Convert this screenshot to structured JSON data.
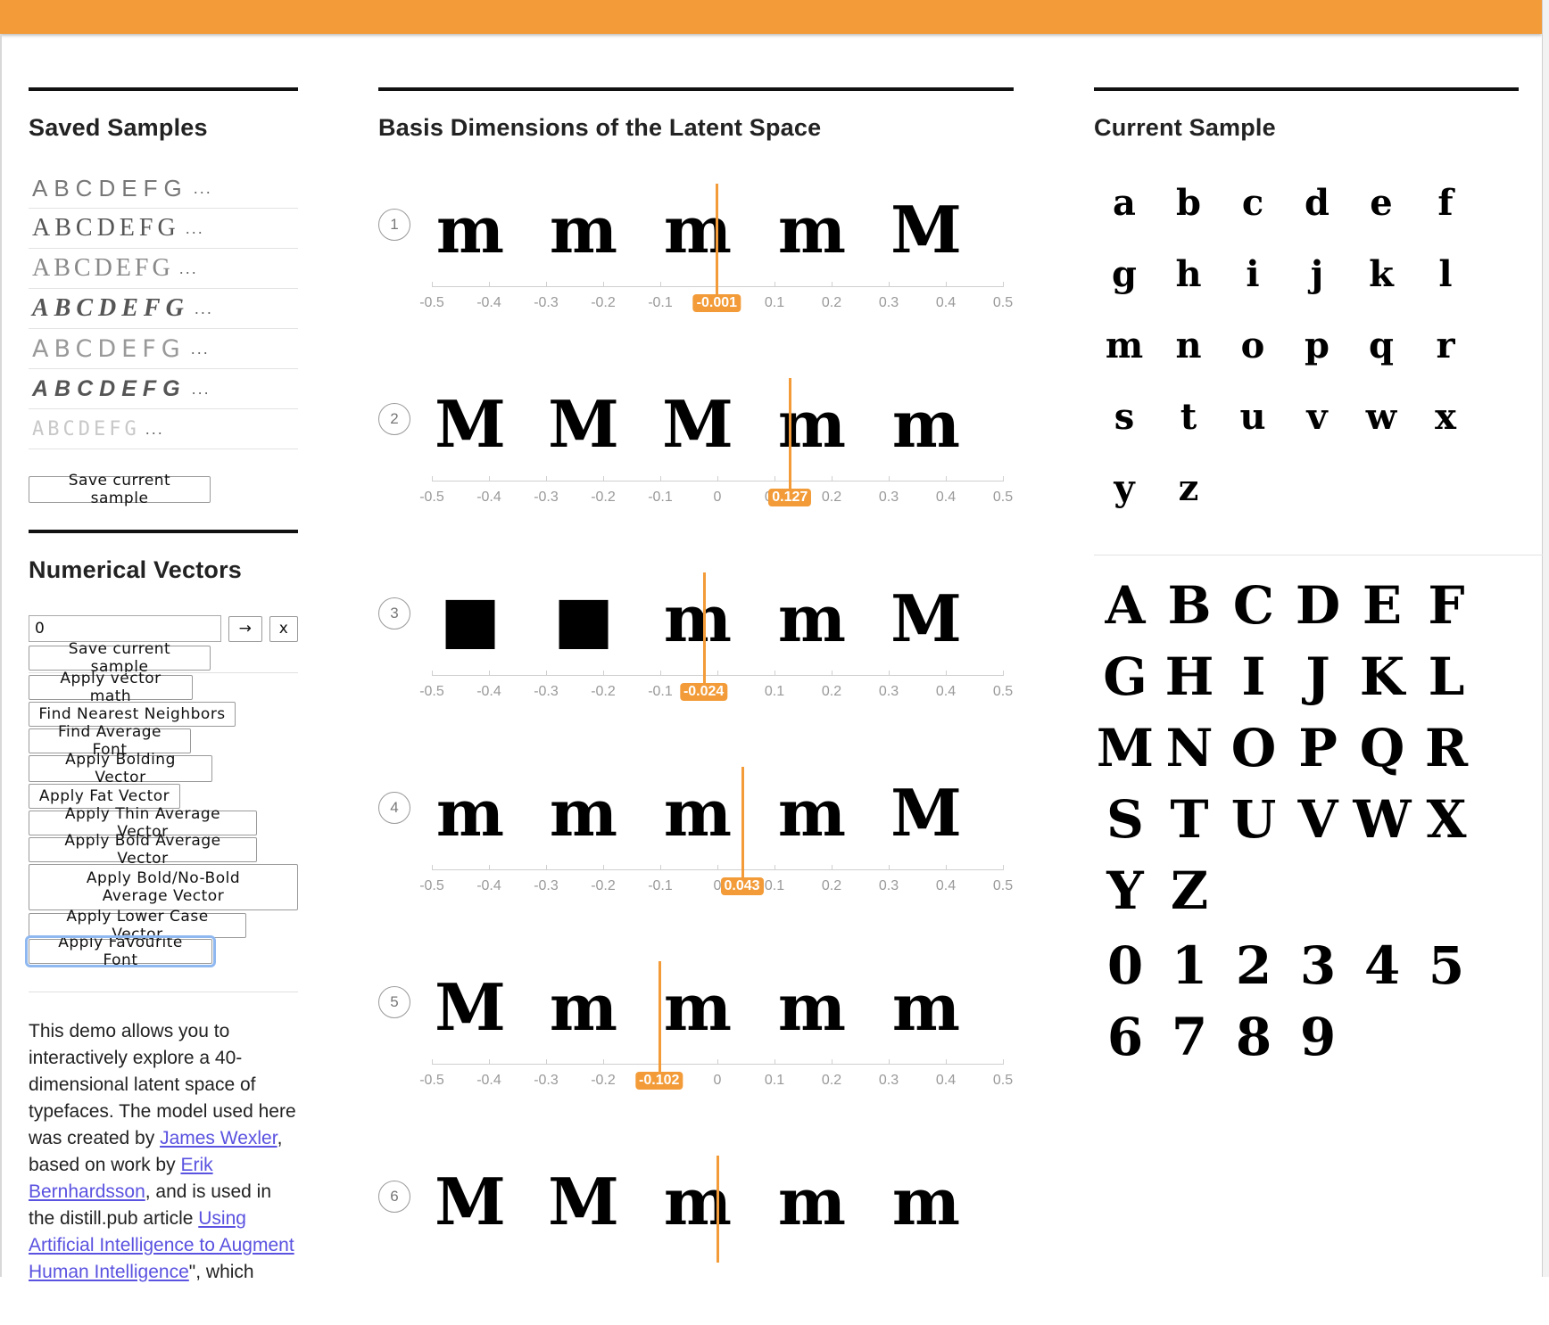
{
  "saved_samples": {
    "title": "Saved Samples",
    "items": [
      {
        "text": "ABCDEFG",
        "ellipsis": "..."
      },
      {
        "text": "ABCDEFG",
        "ellipsis": "..."
      },
      {
        "text": "ABCDEFG",
        "ellipsis": "..."
      },
      {
        "text": "ABCDEFG",
        "ellipsis": "..."
      },
      {
        "text": "ABCDEFG",
        "ellipsis": "..."
      },
      {
        "text": "ABCDEFG",
        "ellipsis": "..."
      },
      {
        "text": "ABCDEFG",
        "ellipsis": "..."
      }
    ],
    "save_button": "Save current sample"
  },
  "numerical_vectors": {
    "title": "Numerical Vectors",
    "input_value": "0",
    "go_button": "→",
    "clear_button": "x",
    "buttons": [
      "Save current sample",
      "Apply vector math",
      "Find Nearest Neighbors",
      "Find Average Font",
      "Apply Bolding Vector",
      "Apply Fat Vector",
      "Apply Thin Average Vector",
      "Apply Bold Average Vector",
      "Apply Bold/No-Bold Average Vector",
      "Apply Lower Case Vector",
      "Apply Favourite Font"
    ]
  },
  "about": {
    "p1": "This demo allows you to interactively explore a 40-dimensional latent space of typefaces. The model used here was created by ",
    "link1": "James Wexler",
    "p2": ", based on work by ",
    "link2": "Erik Bernhardsson",
    "p3": ", and is used in the distill.pub article ",
    "link3": "Using Artificial Intelligence to Augment Human Intelligence",
    "p4": "\", which"
  },
  "basis": {
    "title": "Basis Dimensions of the Latent Space",
    "tick_labels": [
      "-0.5",
      "-0.4",
      "-0.3",
      "-0.2",
      "-0.1",
      "0",
      "0.1",
      "0.2",
      "0.3",
      "0.4",
      "0.5"
    ],
    "dimensions": [
      {
        "number": "1",
        "value": -0.001,
        "label": "-0.001",
        "glyphs": [
          "m",
          "m",
          "m",
          "m",
          "M"
        ]
      },
      {
        "number": "2",
        "value": 0.127,
        "label": "0.127",
        "glyphs": [
          "M",
          "M",
          "M",
          "m",
          "m"
        ]
      },
      {
        "number": "3",
        "value": -0.024,
        "label": "-0.024",
        "glyphs": [
          "■",
          "■",
          "m",
          "m",
          "M"
        ]
      },
      {
        "number": "4",
        "value": 0.043,
        "label": "0.043",
        "glyphs": [
          "m",
          "m",
          "m",
          "m",
          "M"
        ]
      },
      {
        "number": "5",
        "value": -0.102,
        "label": "-0.102",
        "glyphs": [
          "M",
          "m",
          "m",
          "m",
          "m"
        ]
      },
      {
        "number": "6",
        "value": 0.0,
        "label": "",
        "glyphs": [
          "M",
          "M",
          "m",
          "m",
          "m"
        ]
      }
    ]
  },
  "current_sample": {
    "title": "Current Sample",
    "lowercase_glyphs": [
      "a",
      "b",
      "c",
      "d",
      "e",
      "f",
      "g",
      "h",
      "i",
      "j",
      "k",
      "l",
      "m",
      "n",
      "o",
      "p",
      "q",
      "r",
      "s",
      "t",
      "u",
      "v",
      "w",
      "x",
      "y",
      "z"
    ],
    "uppercase_glyphs": [
      "A",
      "B",
      "C",
      "D",
      "E",
      "F",
      "G",
      "H",
      "I",
      "J",
      "K",
      "L",
      "M",
      "N",
      "O",
      "P",
      "Q",
      "R",
      "S",
      "T",
      "U",
      "V",
      "W",
      "X",
      "Y",
      "Z"
    ],
    "digits": [
      "0",
      "1",
      "2",
      "3",
      "4",
      "5",
      "6",
      "7",
      "8",
      "9"
    ]
  },
  "colors": {
    "accent": "#f29b38",
    "link": "#5a52e0"
  }
}
